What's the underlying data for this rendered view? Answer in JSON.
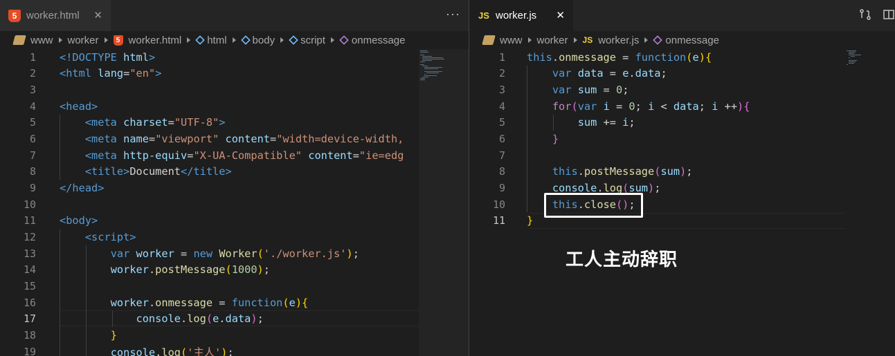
{
  "left": {
    "tab": {
      "title": "worker.html",
      "close": "✕",
      "more": "···"
    },
    "breadcrumb": [
      "www",
      "worker",
      "worker.html",
      "html",
      "body",
      "script",
      "onmessage"
    ],
    "active_line": 17,
    "lines": [
      {
        "n": 1,
        "tokens": [
          [
            "tag",
            "<!DOCTYPE"
          ],
          [
            "plain",
            " "
          ],
          [
            "attr",
            "html"
          ],
          [
            "tag",
            ">"
          ]
        ]
      },
      {
        "n": 2,
        "tokens": [
          [
            "tag",
            "<html"
          ],
          [
            "plain",
            " "
          ],
          [
            "attr",
            "lang"
          ],
          [
            "plain",
            "="
          ],
          [
            "str",
            "\"en\""
          ],
          [
            "tag",
            ">"
          ]
        ]
      },
      {
        "n": 3,
        "tokens": []
      },
      {
        "n": 4,
        "tokens": [
          [
            "tag",
            "<head>"
          ]
        ]
      },
      {
        "n": 5,
        "tokens": [
          [
            "plain",
            "    "
          ],
          [
            "tag",
            "<meta"
          ],
          [
            "plain",
            " "
          ],
          [
            "attr",
            "charset"
          ],
          [
            "plain",
            "="
          ],
          [
            "str",
            "\"UTF-8\""
          ],
          [
            "tag",
            ">"
          ]
        ]
      },
      {
        "n": 6,
        "tokens": [
          [
            "plain",
            "    "
          ],
          [
            "tag",
            "<meta"
          ],
          [
            "plain",
            " "
          ],
          [
            "attr",
            "name"
          ],
          [
            "plain",
            "="
          ],
          [
            "str",
            "\"viewport\""
          ],
          [
            "plain",
            " "
          ],
          [
            "attr",
            "content"
          ],
          [
            "plain",
            "="
          ],
          [
            "str",
            "\"width=device-width,"
          ]
        ]
      },
      {
        "n": 7,
        "tokens": [
          [
            "plain",
            "    "
          ],
          [
            "tag",
            "<meta"
          ],
          [
            "plain",
            " "
          ],
          [
            "attr",
            "http-equiv"
          ],
          [
            "plain",
            "="
          ],
          [
            "str",
            "\"X-UA-Compatible\""
          ],
          [
            "plain",
            " "
          ],
          [
            "attr",
            "content"
          ],
          [
            "plain",
            "="
          ],
          [
            "str",
            "\"ie=edg"
          ]
        ]
      },
      {
        "n": 8,
        "tokens": [
          [
            "plain",
            "    "
          ],
          [
            "tag",
            "<title>"
          ],
          [
            "plain",
            "Document"
          ],
          [
            "tag",
            "</title>"
          ]
        ]
      },
      {
        "n": 9,
        "tokens": [
          [
            "tag",
            "</head>"
          ]
        ]
      },
      {
        "n": 10,
        "tokens": []
      },
      {
        "n": 11,
        "tokens": [
          [
            "tag",
            "<body>"
          ]
        ]
      },
      {
        "n": 12,
        "tokens": [
          [
            "plain",
            "    "
          ],
          [
            "tag",
            "<script>"
          ]
        ]
      },
      {
        "n": 13,
        "tokens": [
          [
            "plain",
            "        "
          ],
          [
            "kw",
            "var"
          ],
          [
            "plain",
            " "
          ],
          [
            "var",
            "worker"
          ],
          [
            "plain",
            " = "
          ],
          [
            "kw",
            "new"
          ],
          [
            "plain",
            " "
          ],
          [
            "fn",
            "Worker"
          ],
          [
            "br1",
            "("
          ],
          [
            "str",
            "'./worker.js'"
          ],
          [
            "br1",
            ")"
          ],
          [
            "plain",
            ";"
          ]
        ]
      },
      {
        "n": 14,
        "tokens": [
          [
            "plain",
            "        "
          ],
          [
            "var",
            "worker"
          ],
          [
            "plain",
            "."
          ],
          [
            "fn",
            "postMessage"
          ],
          [
            "br1",
            "("
          ],
          [
            "num",
            "1000"
          ],
          [
            "br1",
            ")"
          ],
          [
            "plain",
            ";"
          ]
        ]
      },
      {
        "n": 15,
        "tokens": []
      },
      {
        "n": 16,
        "tokens": [
          [
            "plain",
            "        "
          ],
          [
            "var",
            "worker"
          ],
          [
            "plain",
            "."
          ],
          [
            "fn",
            "onmessage"
          ],
          [
            "plain",
            " = "
          ],
          [
            "kw",
            "function"
          ],
          [
            "br1",
            "("
          ],
          [
            "var",
            "e"
          ],
          [
            "br1",
            ")"
          ],
          [
            "br1",
            "{"
          ]
        ]
      },
      {
        "n": 17,
        "tokens": [
          [
            "plain",
            "            "
          ],
          [
            "var",
            "console"
          ],
          [
            "plain",
            "."
          ],
          [
            "fn",
            "log"
          ],
          [
            "br2",
            "("
          ],
          [
            "var",
            "e"
          ],
          [
            "plain",
            "."
          ],
          [
            "var",
            "data"
          ],
          [
            "br2",
            ")"
          ],
          [
            "plain",
            ";"
          ]
        ]
      },
      {
        "n": 18,
        "tokens": [
          [
            "plain",
            "        "
          ],
          [
            "br1",
            "}"
          ]
        ]
      },
      {
        "n": 19,
        "tokens": [
          [
            "plain",
            "        "
          ],
          [
            "var",
            "console"
          ],
          [
            "plain",
            "."
          ],
          [
            "fn",
            "log"
          ],
          [
            "br1",
            "("
          ],
          [
            "str",
            "'主人'"
          ],
          [
            "br1",
            ")"
          ],
          [
            "plain",
            ";"
          ]
        ]
      }
    ]
  },
  "right": {
    "tab": {
      "title": "worker.js",
      "close": "✕"
    },
    "breadcrumb": [
      "www",
      "worker",
      "worker.js",
      "onmessage"
    ],
    "active_line": 11,
    "lines": [
      {
        "n": 1,
        "tokens": [
          [
            "kw",
            "this"
          ],
          [
            "plain",
            "."
          ],
          [
            "fn",
            "onmessage"
          ],
          [
            "plain",
            " = "
          ],
          [
            "kw",
            "function"
          ],
          [
            "br1",
            "("
          ],
          [
            "var",
            "e"
          ],
          [
            "br1",
            ")"
          ],
          [
            "br1",
            "{"
          ]
        ]
      },
      {
        "n": 2,
        "tokens": [
          [
            "plain",
            "    "
          ],
          [
            "kw",
            "var"
          ],
          [
            "plain",
            " "
          ],
          [
            "var",
            "data"
          ],
          [
            "plain",
            " = "
          ],
          [
            "var",
            "e"
          ],
          [
            "plain",
            "."
          ],
          [
            "var",
            "data"
          ],
          [
            "plain",
            ";"
          ]
        ]
      },
      {
        "n": 3,
        "tokens": [
          [
            "plain",
            "    "
          ],
          [
            "kw",
            "var"
          ],
          [
            "plain",
            " "
          ],
          [
            "var",
            "sum"
          ],
          [
            "plain",
            " = "
          ],
          [
            "num",
            "0"
          ],
          [
            "plain",
            ";"
          ]
        ]
      },
      {
        "n": 4,
        "tokens": [
          [
            "plain",
            "    "
          ],
          [
            "ctl",
            "for"
          ],
          [
            "br2",
            "("
          ],
          [
            "kw",
            "var"
          ],
          [
            "plain",
            " "
          ],
          [
            "var",
            "i"
          ],
          [
            "plain",
            " = "
          ],
          [
            "num",
            "0"
          ],
          [
            "plain",
            "; "
          ],
          [
            "var",
            "i"
          ],
          [
            "plain",
            " < "
          ],
          [
            "var",
            "data"
          ],
          [
            "plain",
            "; "
          ],
          [
            "var",
            "i"
          ],
          [
            "plain",
            " ++"
          ],
          [
            "br2",
            ")"
          ],
          [
            "br2",
            "{"
          ]
        ]
      },
      {
        "n": 5,
        "tokens": [
          [
            "plain",
            "        "
          ],
          [
            "var",
            "sum"
          ],
          [
            "plain",
            " += "
          ],
          [
            "var",
            "i"
          ],
          [
            "plain",
            ";"
          ]
        ]
      },
      {
        "n": 6,
        "tokens": [
          [
            "plain",
            "    "
          ],
          [
            "br2",
            "}"
          ]
        ]
      },
      {
        "n": 7,
        "tokens": []
      },
      {
        "n": 8,
        "tokens": [
          [
            "plain",
            "    "
          ],
          [
            "kw",
            "this"
          ],
          [
            "plain",
            "."
          ],
          [
            "fn",
            "postMessage"
          ],
          [
            "br2",
            "("
          ],
          [
            "var",
            "sum"
          ],
          [
            "br2",
            ")"
          ],
          [
            "plain",
            ";"
          ]
        ]
      },
      {
        "n": 9,
        "tokens": [
          [
            "plain",
            "    "
          ],
          [
            "var",
            "console"
          ],
          [
            "plain",
            "."
          ],
          [
            "fn",
            "log"
          ],
          [
            "br2",
            "("
          ],
          [
            "var",
            "sum"
          ],
          [
            "br2",
            ")"
          ],
          [
            "plain",
            ";"
          ]
        ]
      },
      {
        "n": 10,
        "tokens": [
          [
            "plain",
            "    "
          ],
          [
            "kw",
            "this"
          ],
          [
            "plain",
            "."
          ],
          [
            "fn",
            "close"
          ],
          [
            "br2",
            "()"
          ],
          [
            "plain",
            ";"
          ]
        ]
      },
      {
        "n": 11,
        "tokens": [
          [
            "br1",
            "}"
          ]
        ]
      }
    ]
  },
  "annotation": {
    "caption": "工人主动辞职"
  }
}
